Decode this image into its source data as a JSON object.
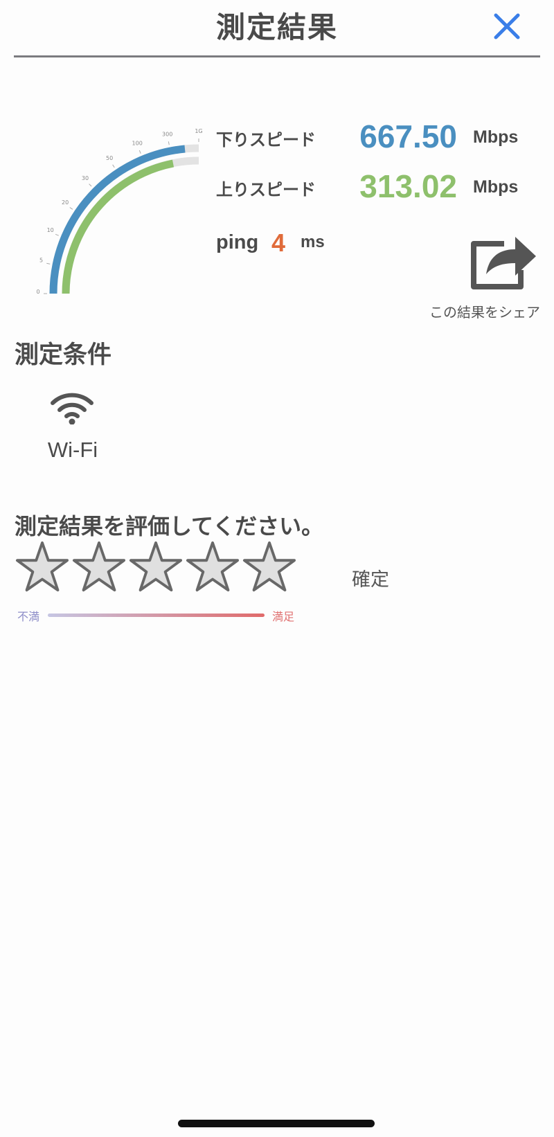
{
  "header": {
    "title": "測定結果"
  },
  "gauge": {
    "ticks": [
      "0",
      "5",
      "10",
      "20",
      "30",
      "50",
      "100",
      "300",
      "1G"
    ],
    "download_color": "#4a8fc0",
    "upload_color": "#8ec06c",
    "track_color": "#e3e3e3"
  },
  "results": {
    "download": {
      "label": "下りスピード",
      "value": "667.50",
      "unit": "Mbps",
      "color": "#4a8fc0"
    },
    "upload": {
      "label": "上りスピード",
      "value": "313.02",
      "unit": "Mbps",
      "color": "#8ec06c"
    },
    "ping": {
      "label": "ping",
      "value": "4",
      "unit": "ms",
      "color": "#e06b3a"
    }
  },
  "share": {
    "label": "この結果をシェア",
    "icon": "share-icon"
  },
  "conditions": {
    "title": "測定条件",
    "network": {
      "icon": "wifi-icon",
      "label": "Wi-Fi"
    }
  },
  "rating": {
    "title": "測定結果を評価してください。",
    "star_count": 5,
    "selected": 0,
    "confirm_label": "確定",
    "scale_low": "不満",
    "scale_high": "満足"
  }
}
